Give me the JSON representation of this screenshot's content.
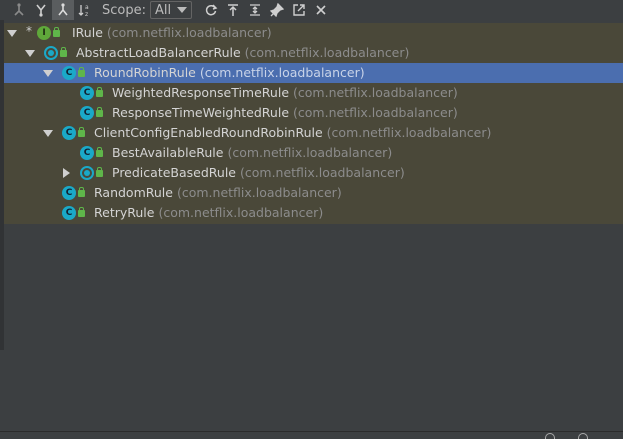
{
  "toolbar": {
    "icons": [
      "supertypes-hierarchy-icon",
      "subtypes-hierarchy-icon",
      "class-hierarchy-icon",
      "sort-alphabetically-icon"
    ],
    "scope_label": "Scope:",
    "scope_value": "All",
    "action_icons": [
      "refresh-icon",
      "export-icon",
      "collapse-all-icon",
      "pin-icon",
      "open-in-new-icon",
      "close-icon"
    ]
  },
  "tree": {
    "rows": [
      {
        "name": "IRule",
        "pkg": "(com.netflix.loadbalancer)"
      },
      {
        "name": "AbstractLoadBalancerRule",
        "pkg": "(com.netflix.loadbalancer)"
      },
      {
        "name": "RoundRobinRule",
        "pkg": "(com.netflix.loadbalancer)"
      },
      {
        "name": "WeightedResponseTimeRule",
        "pkg": "(com.netflix.loadbalancer)"
      },
      {
        "name": "ResponseTimeWeightedRule",
        "pkg": "(com.netflix.loadbalancer)"
      },
      {
        "name": "ClientConfigEnabledRoundRobinRule",
        "pkg": "(com.netflix.loadbalancer)"
      },
      {
        "name": "BestAvailableRule",
        "pkg": "(com.netflix.loadbalancer)"
      },
      {
        "name": "PredicateBasedRule",
        "pkg": "(com.netflix.loadbalancer)"
      },
      {
        "name": "RandomRule",
        "pkg": "(com.netflix.loadbalancer)"
      },
      {
        "name": "RetryRule",
        "pkg": "(com.netflix.loadbalancer)"
      }
    ],
    "interface_letter": "I",
    "class_letter": "C",
    "star": "*"
  },
  "colors": {
    "selection": "#4b6eaf",
    "tree_bg": "#4a4839",
    "class_icon": "#1aa9c8",
    "interface_icon": "#5fa83a"
  }
}
